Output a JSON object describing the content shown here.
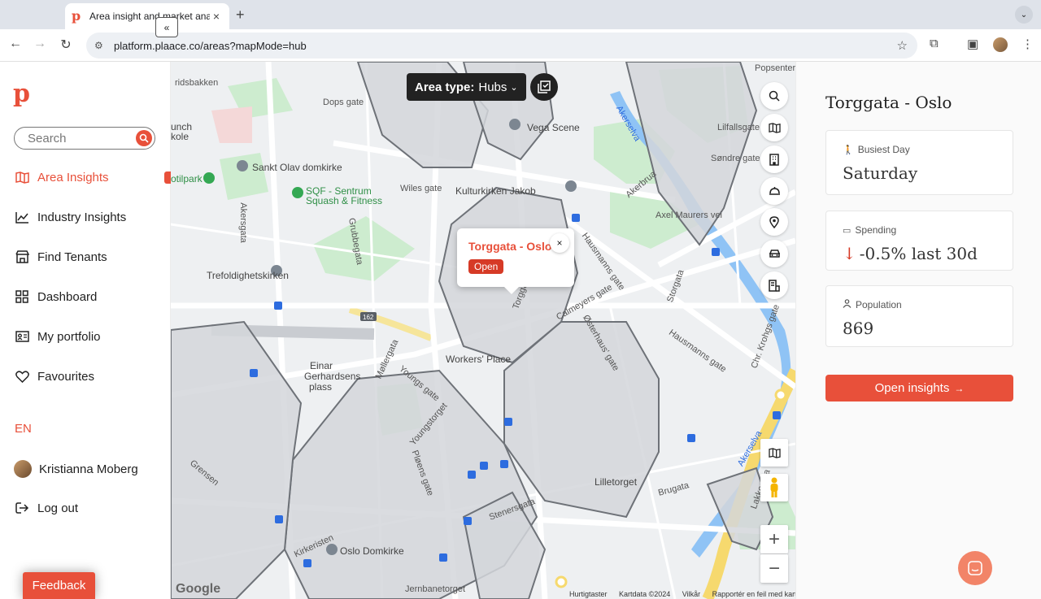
{
  "browser": {
    "tab_title": "Area insight and market analy",
    "tab_close": "×",
    "new_tab": "+",
    "url": "platform.plaace.co/areas?mapMode=hub",
    "back": "←",
    "forward": "→",
    "reload": "↻",
    "bookmark": "☆",
    "extensions": "⧉",
    "menu": "⋮",
    "tab_menu": "⌄"
  },
  "sidebar": {
    "logo": "p",
    "collapse": "«",
    "search_placeholder": "Search",
    "items": [
      {
        "label": "Area Insights",
        "icon": "map-icon",
        "active": true
      },
      {
        "label": "Industry Insights",
        "icon": "chart-icon"
      },
      {
        "label": "Find Tenants",
        "icon": "store-icon"
      },
      {
        "label": "Dashboard",
        "icon": "grid-icon"
      },
      {
        "label": "My portfolio",
        "icon": "id-card-icon"
      },
      {
        "label": "Favourites",
        "icon": "heart-icon"
      }
    ],
    "language": "EN",
    "user_name": "Kristianna Moberg",
    "logout": "Log out",
    "feedback": "Feedback"
  },
  "map": {
    "area_type_label": "Area type:",
    "area_type_value": "Hubs",
    "popup": {
      "title": "Torggata - Oslo",
      "badge": "Open",
      "close": "×"
    },
    "labels": {
      "popsenteret": "Popsenteret",
      "dops_gate": "Dops gate",
      "ridsbakken": "ridsbakken",
      "punch": "unch",
      "kole": "kole",
      "sankt_olav": "Sankt Olav domkirke",
      "sqf1": "SQF - Sentrum",
      "sqf2": "Squash & Fitness",
      "botilpark": "otilpark",
      "akersgata": "Akersgata",
      "wiles_gate": "Wiles gate",
      "kulturkirken": "Kulturkirken Jakob",
      "vega_scene": "Vega Scene",
      "akerselva": "Akerselva",
      "elfallsgate": "Lilfallsgate",
      "sondre_gate": "Søndre gate",
      "akerbrua": "Akerbrua",
      "axel_maurers": "Axel Maurers vei",
      "trefoldighetskirken": "Trefoldighetskirken",
      "grubbegata": "Grubbegata",
      "hausmanns_gate": "Hausmanns gate",
      "storgata": "Storgata",
      "workers_place": "Workers' Place",
      "einar1": "Einar",
      "einar2": "Gerhardsens",
      "einar3": "plass",
      "mollergata": "Møllergata",
      "youngs_gate": "Youngs gate",
      "youngstorget": "Youngstorget",
      "plogens_gate": "Pløens gate",
      "lilletorget": "Lilletorget",
      "brugata": "Brugata",
      "stenersgata": "Stenersgata",
      "oslo_domkirke": "Oslo Domkirke",
      "jernbanetorget": "Jernbanetorget",
      "grensen": "Grensen",
      "kirkeristen": "Kirkeristen",
      "road_162": "162",
      "chr_krohgs": "Chr. Krohgs gate",
      "hausmanns_gate2": "Hausmanns gate",
      "torggata": "Torggata",
      "calmeyers_gate": "Calmeyers gate",
      "osterhaus": "Østerhaus' gate",
      "akerselva2": "Akerselva",
      "lakkegata": "Lakkegata"
    },
    "attribution": [
      "Hurtigtaster",
      "Kartdata ©2024",
      "Vilkår",
      "Rapportér en feil med kartet"
    ],
    "google": "Google",
    "zoom_in": "+",
    "zoom_out": "−"
  },
  "panel": {
    "title": "Torggata - Oslo",
    "busiest_label": "Busiest Day",
    "busiest_value": "Saturday",
    "spending_label": "Spending",
    "spending_value": "-0.5% last 30d",
    "spending_arrow": "↓",
    "population_label": "Population",
    "population_value": "869",
    "open_button": "Open insights",
    "open_arrow": "→"
  },
  "colors": {
    "accent": "#e8503a",
    "negative": "#d63a26",
    "park": "#cdeccf",
    "water": "#8fc3f5",
    "hub": "#d4d6da"
  }
}
